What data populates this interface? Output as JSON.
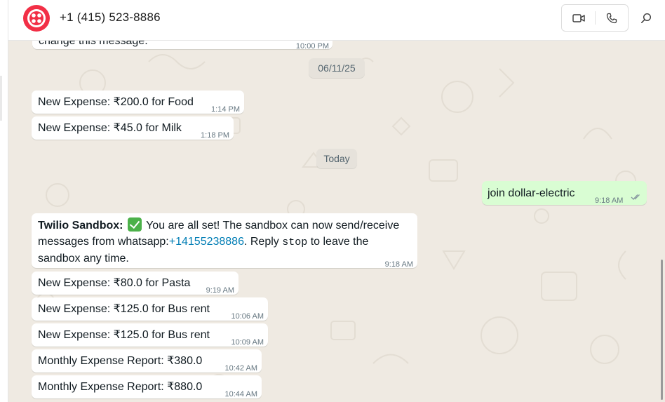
{
  "header": {
    "contact_name": "+1 (415) 523-8886",
    "brand_color": "#f22f46",
    "icons": [
      "twilio-logo",
      "video-call-icon",
      "voice-call-icon",
      "search-icon"
    ]
  },
  "messages": {
    "partial_prev_text": "change this message.",
    "partial_prev_time": "10:00 PM",
    "date1": "06/11/25",
    "m1": {
      "text": "New Expense: ₹200.0 for Food",
      "time": "1:14 PM"
    },
    "m2": {
      "text": "New Expense: ₹45.0 for Milk",
      "time": "1:18 PM"
    },
    "date2": "Today",
    "out1": {
      "text": "join dollar-electric",
      "time": "9:18 AM",
      "status": "read"
    },
    "sandbox": {
      "sender": "Twilio Sandbox:",
      "part1": " You are all set! The sandbox can now send/receive",
      "part2": "messages from whatsapp:",
      "number": "+14155238886",
      "part3": ". Reply ",
      "keyword": "stop",
      "part4": " to leave the",
      "part5": "sandbox any time.",
      "time": "9:18 AM"
    },
    "m3": {
      "text": "New Expense: ₹80.0 for Pasta",
      "time": "9:19 AM"
    },
    "m4": {
      "text": "New Expense: ₹125.0 for Bus rent",
      "time": "10:06 AM"
    },
    "m5": {
      "text": "New Expense: ₹125.0 for Bus rent",
      "time": "10:09 AM"
    },
    "m6": {
      "text": "Monthly Expense Report: ₹380.0",
      "time": "10:42 AM"
    },
    "m7": {
      "text": "Monthly Expense Report: ₹880.0",
      "time": "10:44 AM"
    }
  },
  "colors": {
    "chat_background": "#efeae2",
    "incoming_bubble": "#ffffff",
    "outgoing_bubble": "#d9fdd3",
    "link": "#027eb5",
    "read_ticks": "#53bdeb"
  }
}
